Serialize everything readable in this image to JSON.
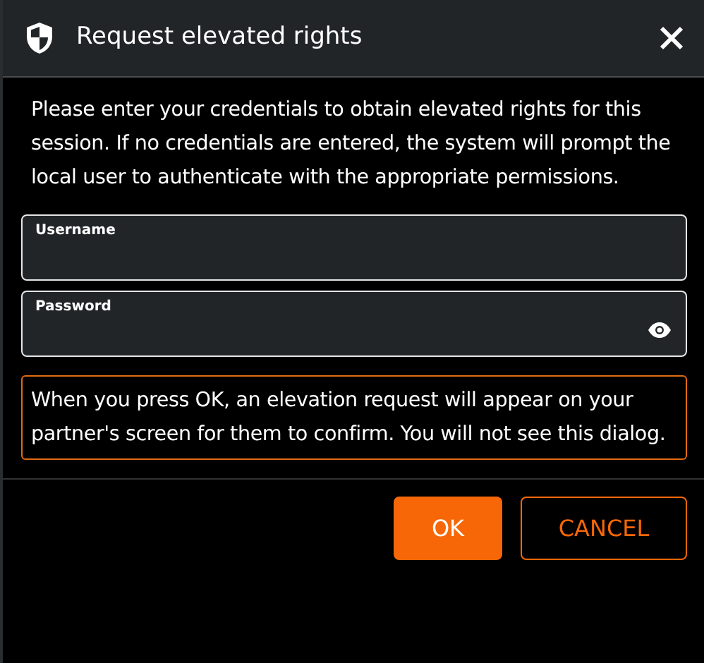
{
  "window": {
    "title": "Request elevated rights"
  },
  "intro": "Please enter your credentials to obtain elevated rights for this session. If no credentials are entered, the system will prompt the local user to authenticate with the appropriate permissions.",
  "fields": [
    {
      "label": "Username",
      "kind": "text"
    },
    {
      "label": "Password",
      "kind": "password"
    }
  ],
  "notice": "When you press OK, an elevation request will appear on your partner's screen for them to confirm. You will not see this dialog.",
  "buttons": [
    {
      "label": "OK",
      "kind": "primary"
    },
    {
      "label": "CANCEL",
      "kind": "secondary"
    }
  ]
}
